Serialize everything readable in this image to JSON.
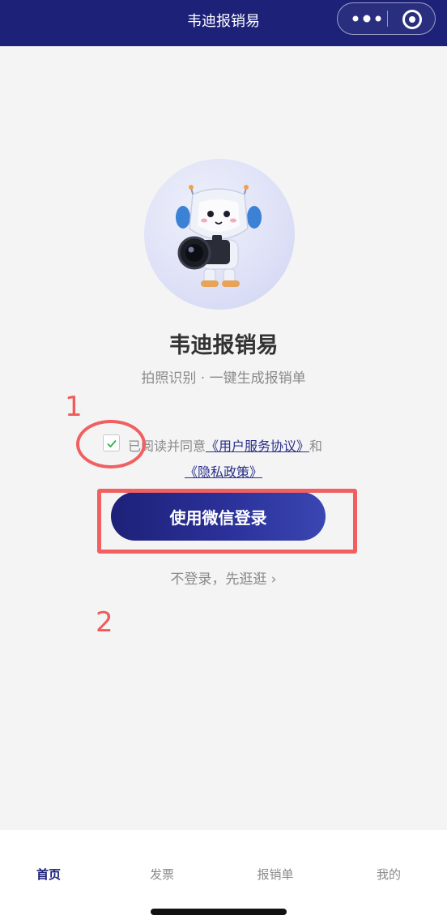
{
  "nav": {
    "title": "韦迪报销易",
    "more_icon": "more-dots-icon",
    "close_icon": "target-circle-icon"
  },
  "hero": {
    "avatar_icon": "robot-camera-mascot",
    "app_name": "韦迪报销易",
    "tagline": "拍照识别 · 一键生成报销单"
  },
  "annotations": {
    "label_1": "1",
    "label_2": "2",
    "color": "#f06060"
  },
  "agreement": {
    "checked": true,
    "prefix": "已阅读并同意",
    "user_agreement": "《用户服务协议》",
    "and": "和",
    "privacy_policy": "《隐私政策》"
  },
  "login": {
    "button_label": "使用微信登录",
    "skip_label": "不登录，先逛逛 ›"
  },
  "tabbar": {
    "tabs": [
      {
        "label": "首页",
        "active": true
      },
      {
        "label": "发票",
        "active": false
      },
      {
        "label": "报销单",
        "active": false
      },
      {
        "label": "我的",
        "active": false
      }
    ]
  },
  "colors": {
    "brand": "#1d2178",
    "link": "#2b2f8a",
    "check": "#2fb04a",
    "background": "#f4f4f5"
  }
}
